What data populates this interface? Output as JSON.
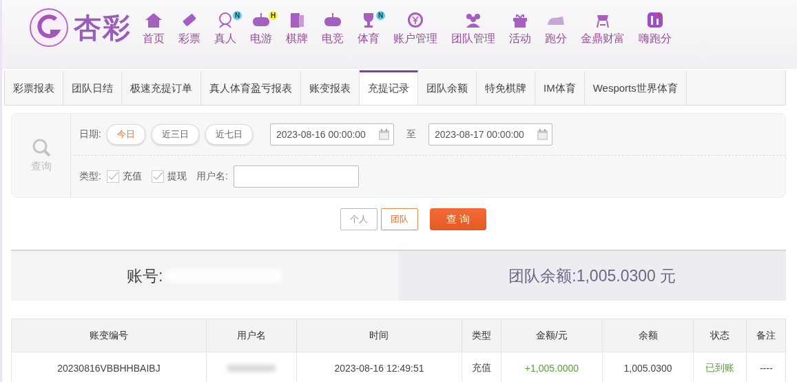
{
  "header": {
    "logo_text": "杏彩",
    "nav": [
      {
        "label": "首页"
      },
      {
        "label": "彩票"
      },
      {
        "label": "真人",
        "badge": {
          "text": "N",
          "color": "#4fd4f0"
        }
      },
      {
        "label": "电游",
        "badge": {
          "text": "H",
          "color": "#f5f53a"
        }
      },
      {
        "label": "棋牌"
      },
      {
        "label": "电竞"
      },
      {
        "label": "体育",
        "badge": {
          "text": "N",
          "color": "#4fd4f0"
        }
      },
      {
        "label": "账户管理"
      },
      {
        "label": "团队管理"
      },
      {
        "label": "活动"
      },
      {
        "label": "跑分"
      },
      {
        "label": "金鼎财富"
      },
      {
        "label": "嗨跑分"
      }
    ]
  },
  "tabs": [
    {
      "label": "彩票报表",
      "selected": false
    },
    {
      "label": "团队日结",
      "selected": false
    },
    {
      "label": "极速充提订单",
      "selected": false
    },
    {
      "label": "真人体育盈亏报表",
      "selected": false
    },
    {
      "label": "账变报表",
      "selected": false
    },
    {
      "label": "充提记录",
      "selected": true
    },
    {
      "label": "团队余额",
      "selected": false
    },
    {
      "label": "特免棋牌",
      "selected": false
    },
    {
      "label": "IM体育",
      "selected": false
    },
    {
      "label": "Wesports世界体育",
      "selected": false
    }
  ],
  "filter": {
    "search_label": "查询",
    "date_label": "日期:",
    "quick_dates": [
      {
        "label": "今日",
        "selected": true
      },
      {
        "label": "近三日",
        "selected": false
      },
      {
        "label": "近七日",
        "selected": false
      }
    ],
    "start": "2023-08-16 00:00:00",
    "to_label": "至",
    "end": "2023-08-17 00:00:00",
    "type_label": "类型:",
    "types": [
      {
        "label": "充值",
        "checked": true
      },
      {
        "label": "提现",
        "checked": true
      }
    ],
    "username_label": "用户名:"
  },
  "scope": [
    {
      "label": "个人",
      "selected": false
    },
    {
      "label": "团队",
      "selected": true
    }
  ],
  "query_button": "查 询",
  "summary": {
    "account_label": "账号:",
    "balance": "团队余额:1,005.0300 元"
  },
  "table": {
    "columns": [
      "账变编号",
      "用户名",
      "时间",
      "类型",
      "金额/元",
      "余额",
      "状态",
      "备注"
    ],
    "rows": [
      {
        "cells": [
          "20230816VBBHHBAIBJ",
          null,
          "2023-08-16 12:49:51",
          "充值",
          "+1,005.0000",
          "1,005.0300",
          "已到账",
          "----"
        ]
      }
    ]
  }
}
